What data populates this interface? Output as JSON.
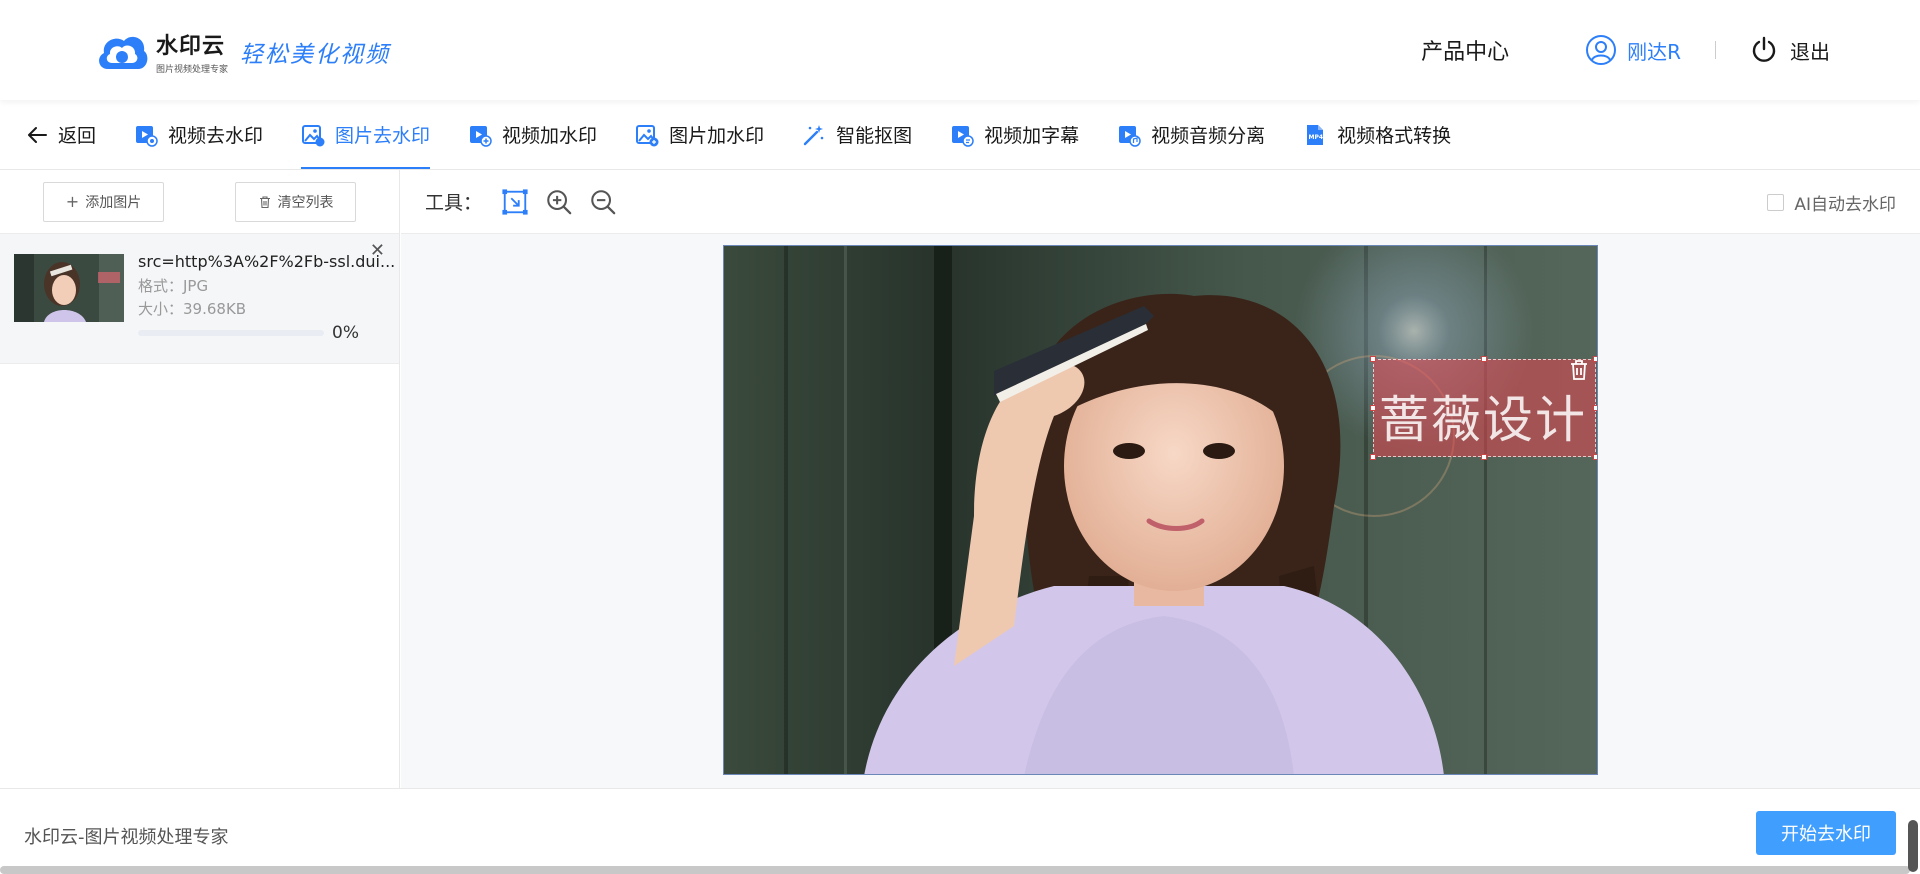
{
  "header": {
    "brand_name": "水印云",
    "brand_sub": "图片视频处理专家",
    "slogan": "轻松美化视频",
    "product_center": "产品中心",
    "user_name": "刚达R",
    "logout": "退出"
  },
  "nav": {
    "back": "返回",
    "tabs": [
      {
        "label": "视频去水印",
        "icon": "video-icon"
      },
      {
        "label": "图片去水印",
        "icon": "image-icon",
        "active": true
      },
      {
        "label": "视频加水印",
        "icon": "video-icon"
      },
      {
        "label": "图片加水印",
        "icon": "image-icon"
      },
      {
        "label": "智能抠图",
        "icon": "magic-wand-icon"
      },
      {
        "label": "视频加字幕",
        "icon": "video-icon"
      },
      {
        "label": "视频音频分离",
        "icon": "video-icon"
      },
      {
        "label": "视频格式转换",
        "icon": "mp4-file-icon"
      }
    ]
  },
  "left_toolbar": {
    "add_label": "添加图片",
    "clear_label": "清空列表"
  },
  "files": [
    {
      "name": "src=http%3A%2F%2Fb-ssl.dui...",
      "format": "格式：JPG",
      "size": "大小：39.68KB",
      "progress": 0,
      "progress_text": "0%"
    }
  ],
  "tools": {
    "label": "工具：",
    "ai_auto_label": "AI自动去水印"
  },
  "watermark": {
    "text": "蔷薇设计"
  },
  "footer": {
    "text": "水印云-图片视频处理专家",
    "start_button": "开始去水印"
  },
  "colors": {
    "accent": "#2d7ff9",
    "button": "#409eff"
  }
}
